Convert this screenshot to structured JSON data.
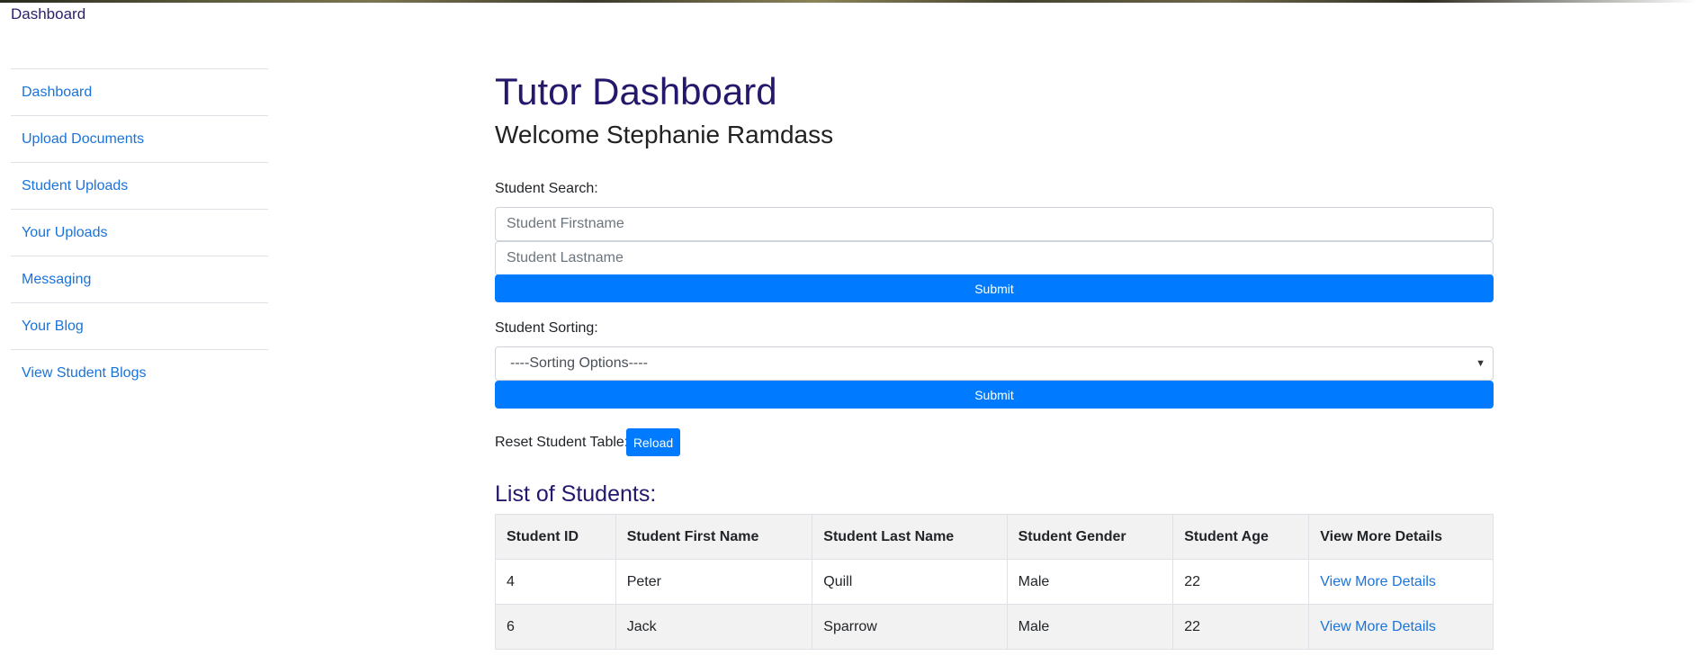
{
  "nav": {
    "top_link": "Dashboard"
  },
  "sidebar": {
    "items": [
      {
        "label": "Dashboard"
      },
      {
        "label": "Upload Documents"
      },
      {
        "label": "Student Uploads"
      },
      {
        "label": "Your Uploads"
      },
      {
        "label": "Messaging"
      },
      {
        "label": "Your Blog"
      },
      {
        "label": "View Student Blogs"
      }
    ]
  },
  "main": {
    "title": "Tutor Dashboard",
    "welcome": "Welcome Stephanie Ramdass",
    "search": {
      "label": "Student Search:",
      "firstname_placeholder": "Student Firstname",
      "lastname_placeholder": "Student Lastname",
      "submit_label": "Submit"
    },
    "sorting": {
      "label": "Student Sorting:",
      "selected": "----Sorting Options----",
      "submit_label": "Submit"
    },
    "reset": {
      "label": "Reset Student Table:",
      "button_label": "Reload"
    },
    "list_title": "List of Students:",
    "table": {
      "headers": [
        "Student ID",
        "Student First Name",
        "Student Last Name",
        "Student Gender",
        "Student Age",
        "View More Details"
      ],
      "rows": [
        {
          "id": "4",
          "first": "Peter",
          "last": "Quill",
          "gender": "Male",
          "age": "22",
          "link": "View More Details"
        },
        {
          "id": "6",
          "first": "Jack",
          "last": "Sparrow",
          "gender": "Male",
          "age": "22",
          "link": "View More Details"
        }
      ]
    }
  },
  "colors": {
    "accent": "#007bff",
    "heading": "#23186b",
    "link": "#1a73d9"
  }
}
